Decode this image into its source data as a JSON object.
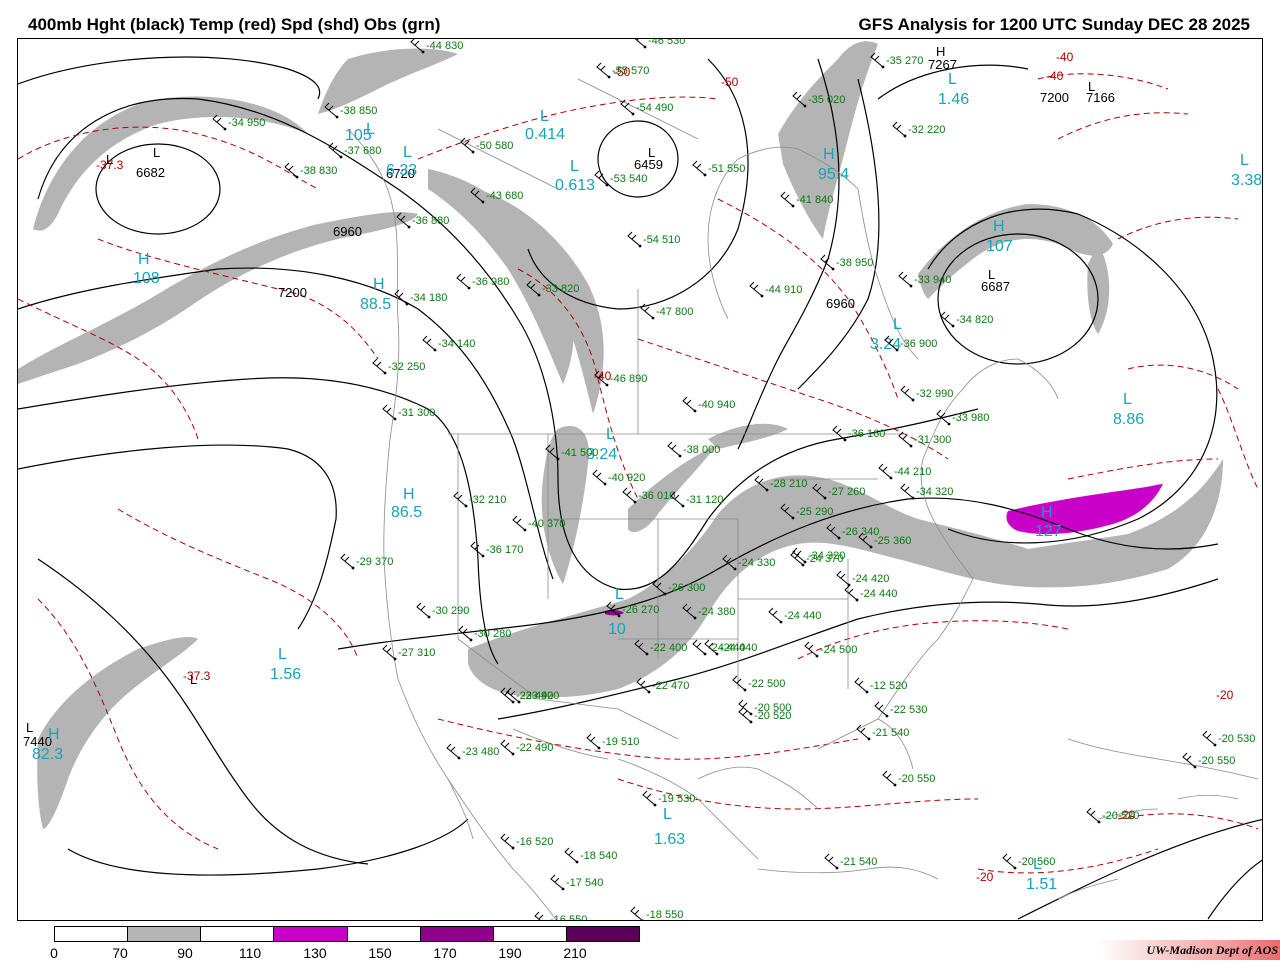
{
  "header": {
    "title_left": "400mb Hght (black) Temp (red) Spd (shd) Obs (grn)",
    "title_right": "GFS Analysis for 1200 UTC Sunday  DEC 28 2025"
  },
  "legend": {
    "ticks": [
      "0",
      "70",
      "90",
      "110",
      "130",
      "150",
      "170",
      "190",
      "210"
    ],
    "colors": [
      "#ffffff",
      "#b4b4b4",
      "#ffffff",
      "#c800c8",
      "#ffffff",
      "#8c008c",
      "#ffffff",
      "#5a005a"
    ]
  },
  "colors": {
    "height": "#000000",
    "temp": "#b00000",
    "speed": "#b4b4b4",
    "speed_strong": "#c800c8",
    "centers": "#17a3ba",
    "obs": "#0c7a10"
  },
  "credit": "UW-Madison  Dept of AOS",
  "height_labels": [
    "6682",
    "6720",
    "6960",
    "7200",
    "6459",
    "6960",
    "6687",
    "7267",
    "7200",
    "7166",
    "7440"
  ],
  "temp_labels": [
    "-37.3",
    "-40",
    "-40",
    "-50",
    "-50",
    "-40",
    "-37.3",
    "-20",
    "-20",
    "-20"
  ],
  "centers": [
    {
      "type": "L",
      "value": "0.414"
    },
    {
      "type": "L",
      "value": "6.33"
    },
    {
      "type": "L",
      "value": "0.613"
    },
    {
      "type": "H",
      "value": "108"
    },
    {
      "type": "H",
      "value": "88.5"
    },
    {
      "type": "H",
      "value": "86.5"
    },
    {
      "type": "L",
      "value": "1.46"
    },
    {
      "type": "L",
      "value": "3.38"
    },
    {
      "type": "H",
      "value": "107"
    },
    {
      "type": "H",
      "value": "95.4"
    },
    {
      "type": "L",
      "value": "8.86"
    },
    {
      "type": "H",
      "value": "127"
    },
    {
      "type": "L",
      "value": "3.24"
    },
    {
      "type": "L",
      "value": "3.24"
    },
    {
      "type": "L",
      "value": "10"
    },
    {
      "type": "L",
      "value": "1.56"
    },
    {
      "type": "H",
      "value": "82.3"
    },
    {
      "type": "L",
      "value": "1.63"
    },
    {
      "type": "L",
      "value": "1.51"
    },
    {
      "type": "L",
      "value": "105"
    }
  ],
  "observations": [
    "-44 830",
    "-46 530",
    "-55 570",
    "-38 850",
    "-34 950",
    "-37 680",
    "-38 830",
    "-54 490",
    "-50 580",
    "-53 540",
    "-51 550",
    "-35 020",
    "-35 270",
    "-32 220",
    "-36 880",
    "-43 680",
    "-54 510",
    "-41 840",
    "-38 950",
    "-36 980",
    "-33 820",
    "-44 910",
    "-47 800",
    "-33 940",
    "-34 180",
    "-34 140",
    "-34 820",
    "-36 900",
    "-32 250",
    "-46 890",
    "-40 940",
    "-32 990",
    "-33 980",
    "-31 300",
    "-36 160",
    "-31 300",
    "-41 500",
    "-40 920",
    "-38 000",
    "-32 210",
    "-36 010",
    "-44 210",
    "-28 210",
    "-27 260",
    "-34 320",
    "-31 120",
    "-25 290",
    "-40 370",
    "-26 340",
    "-25 360",
    "-34 320",
    "-29 370",
    "-36 170",
    "-24 330",
    "-24 370",
    "-24 420",
    "-24 440",
    "-30 290",
    "-26 270",
    "-26 300",
    "-24 380",
    "-24 440",
    "-24 440",
    "-30 280",
    "-27 310",
    "-22 400",
    "-24 440",
    "-24 500",
    "-23 490",
    "-22 470",
    "-22 500",
    "-20 500",
    "-12 520",
    "-23 420",
    "-20 520",
    "-22 530",
    "-23 480",
    "-22 490",
    "-19 510",
    "-21 540",
    "-20 550",
    "-19 530",
    "-16 520",
    "-18 540",
    "-17 540",
    "-16 550",
    "-18 550",
    "-21 540",
    "-20 560",
    "-20 530",
    "-20 550",
    "-20 520"
  ]
}
